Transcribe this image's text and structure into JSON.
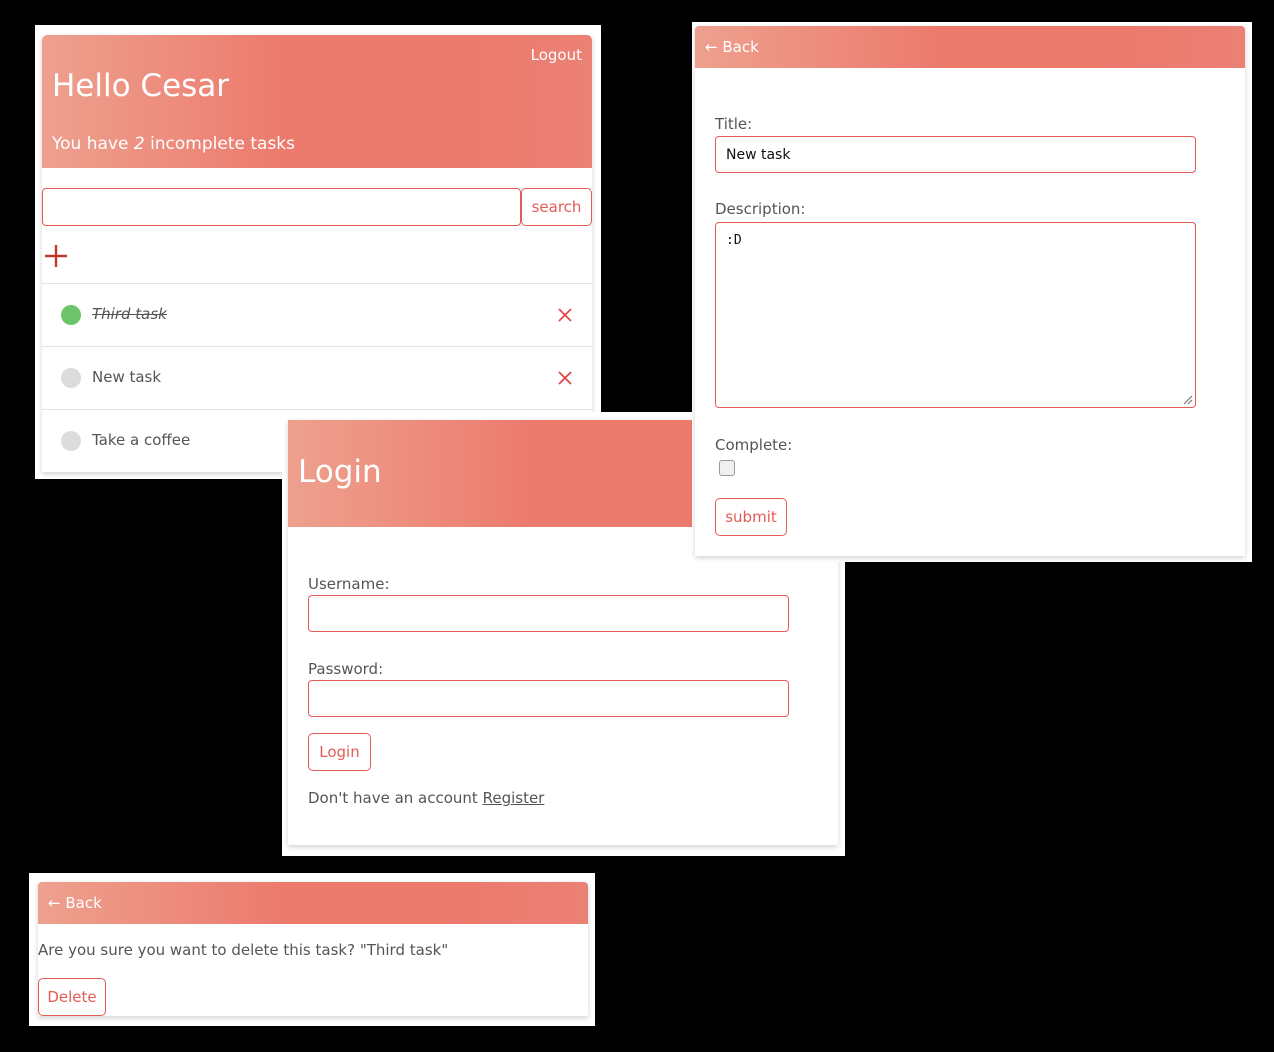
{
  "colors": {
    "accent": "#e45b55",
    "header_gradient_start": "#eea08e",
    "header_gradient_end": "#ec7a6d",
    "complete_dot": "#6cc46a",
    "incomplete_dot": "#dcdcdc",
    "background": "#000000"
  },
  "home": {
    "logout": "Logout",
    "greeting": "Hello Cesar",
    "summary_prefix": "You have",
    "incomplete_count": "2",
    "summary_suffix": "incomplete tasks",
    "search_value": "",
    "search_button": "search",
    "add_icon": "plus-icon",
    "tasks": [
      {
        "title": "Third task",
        "complete": true
      },
      {
        "title": "New task",
        "complete": false
      },
      {
        "title": "Take a coffee",
        "complete": false
      }
    ],
    "delete_icon": "close-icon"
  },
  "edit": {
    "back": "← Back",
    "title_label": "Title:",
    "title_value": "New task",
    "description_label": "Description:",
    "description_value": ":D",
    "complete_label": "Complete:",
    "complete_checked": false,
    "submit": "submit"
  },
  "login": {
    "title": "Login",
    "username_label": "Username:",
    "username_value": "",
    "password_label": "Password:",
    "password_value": "",
    "login_button": "Login",
    "no_account_text": "Don't have an account",
    "register_link": "Register"
  },
  "delete_confirm": {
    "back": "← Back",
    "message": "Are you sure you want to delete this task? \"Third task\"",
    "delete_button": "Delete"
  }
}
